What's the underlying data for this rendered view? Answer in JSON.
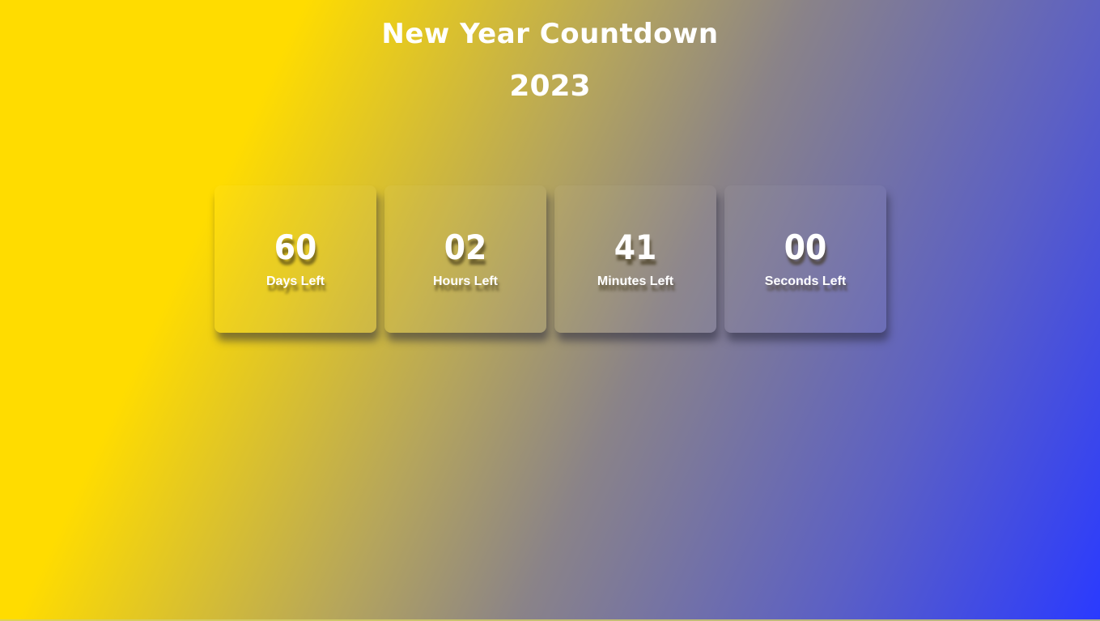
{
  "header": {
    "title": "New Year Countdown",
    "year": "2023"
  },
  "countdown": [
    {
      "value": "60",
      "label": "Days Left"
    },
    {
      "value": "02",
      "label": "Hours Left"
    },
    {
      "value": "41",
      "label": "Minutes Left"
    },
    {
      "value": "00",
      "label": "Seconds Left"
    }
  ],
  "colors": {
    "gradient_start": "#ffdc00",
    "gradient_end": "#2a3aff",
    "text": "#ffffff"
  }
}
